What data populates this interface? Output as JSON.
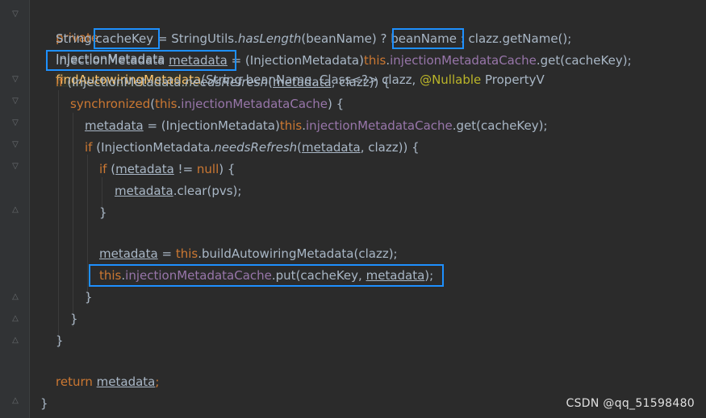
{
  "code": {
    "l1": {
      "kw_private": "private",
      "ret_type": "InjectionMetadata",
      "method": "findAutowiringMetadata",
      "params_a": "(String beanName, Class<?> clazz, ",
      "annotation": "@Nullable",
      "params_b": " PropertyV"
    },
    "l2": {
      "a": "String ",
      "cacheKey": "cacheKey",
      "b": " = StringUtils.",
      "hasLength": "hasLength",
      "c": "(beanName) ? ",
      "beanName": "beanName",
      "d": " : clazz.getName();"
    },
    "l3": {
      "a": "InjectionMetadata ",
      "metadata": "metadata",
      "b": " = (InjectionMetadata)",
      "this": "this",
      "dot": ".",
      "cache": "injectionMetadataCache",
      "c": ".get(cacheKey);"
    },
    "l4": {
      "kw_if": "if",
      "a": " (InjectionMetadata.",
      "needsRefresh": "needsRefresh",
      "b": "(",
      "metadata": "metadata",
      "c": ", clazz)) {"
    },
    "l5": {
      "kw_sync": "synchronized",
      "a": "(",
      "this": "this",
      "dot": ".",
      "cache": "injectionMetadataCache",
      "b": ") {"
    },
    "l6": {
      "metadata": "metadata",
      "a": " = (InjectionMetadata)",
      "this": "this",
      "dot": ".",
      "cache": "injectionMetadataCache",
      "b": ".get(cacheKey);"
    },
    "l7": {
      "kw_if": "if",
      "a": " (InjectionMetadata.",
      "needsRefresh": "needsRefresh",
      "b": "(",
      "metadata": "metadata",
      "c": ", clazz)) {"
    },
    "l8": {
      "kw_if": "if",
      "a": " (",
      "metadata": "metadata",
      "b": " != ",
      "kw_null": "null",
      "c": ") {"
    },
    "l9": {
      "metadata": "metadata",
      "a": ".clear(pvs);"
    },
    "l10": {
      "brace": "}"
    },
    "l12": {
      "metadata": "metadata",
      "a": " = ",
      "this": "this",
      "b": ".buildAutowiringMetadata(clazz);"
    },
    "l13": {
      "this": "this",
      "dot": ".",
      "cache": "injectionMetadataCache",
      "a": ".put(cacheKey, ",
      "metadata": "metadata",
      "b": ");"
    },
    "l14": {
      "brace": "}"
    },
    "l15": {
      "brace": "}"
    },
    "l16": {
      "brace": "}"
    },
    "l18": {
      "kw_return": "return",
      "sp": " ",
      "metadata": "metadata",
      "semi": ";"
    },
    "l19": {
      "brace": "}"
    }
  },
  "watermark": "CSDN @qq_51598480",
  "colors": {
    "background": "#2b2b2b",
    "keyword": "#cc7832",
    "method": "#ffc66d",
    "field": "#9876aa",
    "annotation": "#bbb529",
    "highlight_box": "#1e90ff"
  }
}
